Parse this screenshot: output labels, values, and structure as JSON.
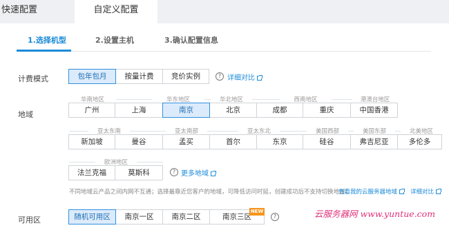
{
  "tabs": [
    {
      "label": "快速配置"
    },
    {
      "label": "自定义配置"
    }
  ],
  "steps": [
    {
      "label": "1.选择机型"
    },
    {
      "label": "2.设置主机"
    },
    {
      "label": "3.确认配置信息"
    }
  ],
  "billing": {
    "label": "计费模式",
    "options": [
      "包年包月",
      "按量计费",
      "竞价实例"
    ],
    "selected": "包年包月",
    "compare_link": "详细对比"
  },
  "region": {
    "label": "地域",
    "groups_row1": [
      "华南地区",
      "华东地区",
      "华北地区",
      "西南地区",
      "港澳台地区"
    ],
    "cities_row1": [
      "广州",
      "上海",
      "南京",
      "北京",
      "成都",
      "重庆",
      "中国香港"
    ],
    "groups_row2": [
      "亚太东南",
      "亚太南部",
      "亚太东北",
      "美国西部",
      "美国东部",
      "北美地区"
    ],
    "cities_row2": [
      "新加坡",
      "曼谷",
      "孟买",
      "首尔",
      "东京",
      "硅谷",
      "弗吉尼亚",
      "多伦多"
    ],
    "groups_row3": [
      "欧洲地区"
    ],
    "cities_row3": [
      "法兰克福",
      "莫斯科"
    ],
    "selected": "南京",
    "more_link": "更多地域",
    "note": "不同地域云产品之间内网不互通；选择最靠近您客户的地域，可降低访问时延，创建成功后不支持切换地域。",
    "note_link": "查看我的云服务器地域",
    "detail_link": "详细对比"
  },
  "zone": {
    "label": "可用区",
    "options": [
      "随机可用区",
      "南京一区",
      "南京二区",
      "南京三区"
    ],
    "selected": "随机可用区",
    "badge": "NEW"
  },
  "watermark": "云服务器网 www.yuntue.com"
}
